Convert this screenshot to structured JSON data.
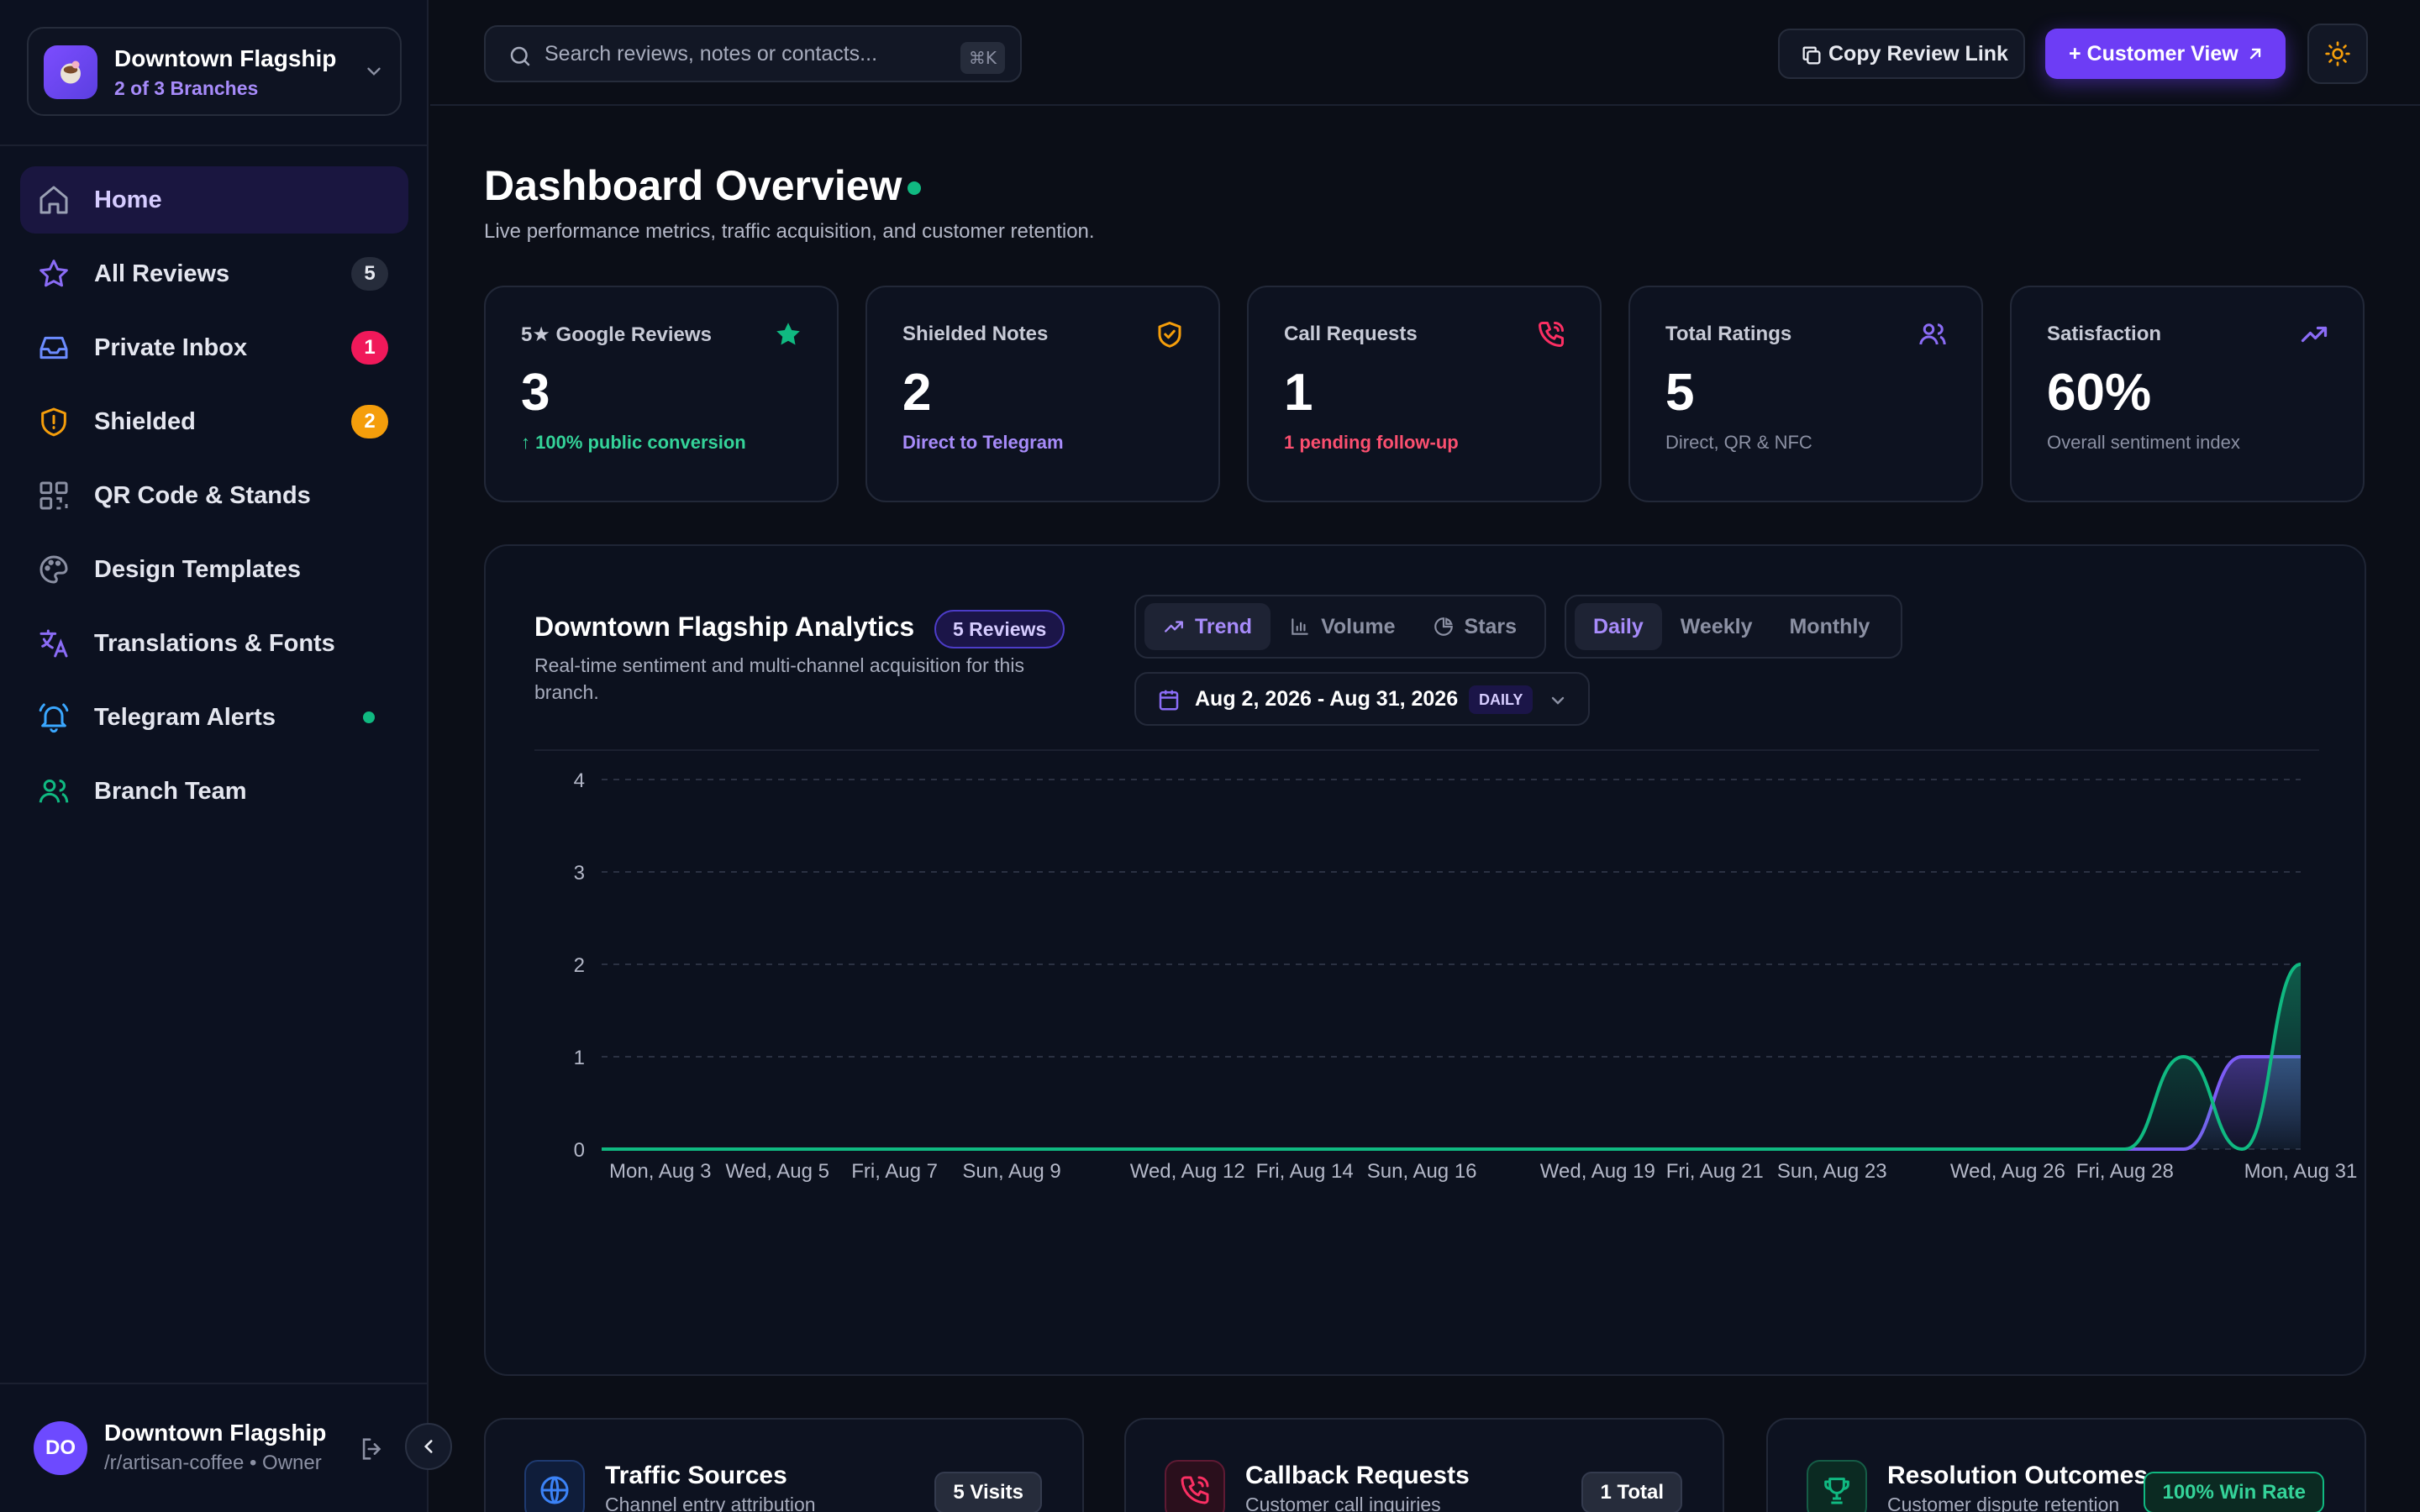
{
  "branch": {
    "name": "Downtown Flagship",
    "sub": "2 of 3 Branches"
  },
  "nav": [
    {
      "label": "Home",
      "icon": "home-icon"
    },
    {
      "label": "All Reviews",
      "badge": "5",
      "icon": "star-icon"
    },
    {
      "label": "Private Inbox",
      "badge": "1",
      "icon": "inbox-icon"
    },
    {
      "label": "Shielded",
      "badge": "2",
      "icon": "shield-icon"
    },
    {
      "label": "QR Code & Stands",
      "icon": "qr-code-icon"
    },
    {
      "label": "Design Templates",
      "icon": "palette-icon"
    },
    {
      "label": "Translations & Fonts",
      "icon": "languages-icon"
    },
    {
      "label": "Telegram Alerts",
      "icon": "bell-icon"
    },
    {
      "label": "Branch Team",
      "icon": "users-icon"
    }
  ],
  "user": {
    "initials": "DO",
    "name": "Downtown Flagship",
    "sub": "/r/artisan-coffee • Owner"
  },
  "topbar": {
    "search_placeholder": "Search reviews, notes or contacts...",
    "shortcut": "⌘K",
    "copy_label": "Copy Review Link",
    "customer_label": "+ Customer View"
  },
  "page": {
    "title": "Dashboard Overview",
    "subtitle": "Live performance metrics, traffic acquisition, and customer retention."
  },
  "stats": [
    {
      "label": "5★ Google Reviews",
      "value": "3",
      "note": "↑ 100% public conversion",
      "color": "#34d399",
      "icon": "star-icon"
    },
    {
      "label": "Shielded Notes",
      "value": "2",
      "note": "Direct to Telegram",
      "color": "#a78bfa",
      "icon": "shield-check-icon"
    },
    {
      "label": "Call Requests",
      "value": "1",
      "note": "1 pending follow-up",
      "color": "#fb4f6f",
      "icon": "phone-call-icon"
    },
    {
      "label": "Total Ratings",
      "value": "5",
      "note": "Direct, QR & NFC",
      "color": "#8b90a3",
      "icon": "users-icon"
    },
    {
      "label": "Satisfaction",
      "value": "60%",
      "note": "Overall sentiment index",
      "color": "#8b90a3",
      "icon": "trending-up-icon"
    }
  ],
  "analytics": {
    "title": "Downtown Flagship Analytics",
    "badge": "5 Reviews",
    "subtitle": "Real-time sentiment and multi-channel acquisition for this branch.",
    "views": [
      "Trend",
      "Volume",
      "Stars"
    ],
    "active_view": "Trend",
    "periods": [
      "Daily",
      "Weekly",
      "Monthly"
    ],
    "active_period": "Daily",
    "date_range": "Aug 2, 2026 - Aug 31, 2026",
    "date_tag": "DAILY"
  },
  "chart_data": {
    "type": "area",
    "title": "",
    "xlabel": "",
    "ylabel": "",
    "ylim": [
      0,
      4
    ],
    "yticks": [
      0,
      1,
      2,
      3,
      4
    ],
    "grid": true,
    "x": [
      "Aug 2",
      "Aug 3",
      "Aug 4",
      "Aug 5",
      "Aug 6",
      "Aug 7",
      "Aug 8",
      "Aug 9",
      "Aug 10",
      "Aug 11",
      "Aug 12",
      "Aug 13",
      "Aug 14",
      "Aug 15",
      "Aug 16",
      "Aug 17",
      "Aug 18",
      "Aug 19",
      "Aug 20",
      "Aug 21",
      "Aug 22",
      "Aug 23",
      "Aug 24",
      "Aug 25",
      "Aug 26",
      "Aug 27",
      "Aug 28",
      "Aug 29",
      "Aug 30",
      "Aug 31"
    ],
    "xtick_labels": [
      "Mon, Aug 3",
      "Wed, Aug 5",
      "Fri, Aug 7",
      "Sun, Aug 9",
      "Wed, Aug 12",
      "Fri, Aug 14",
      "Sun, Aug 16",
      "Wed, Aug 19",
      "Fri, Aug 21",
      "Sun, Aug 23",
      "Wed, Aug 26",
      "Fri, Aug 28",
      "Mon, Aug 31"
    ],
    "xtick_index": [
      1,
      3,
      5,
      7,
      10,
      12,
      14,
      17,
      19,
      21,
      24,
      26,
      29
    ],
    "series": [
      {
        "color": "#10b981",
        "values": [
          0,
          0,
          0,
          0,
          0,
          0,
          0,
          0,
          0,
          0,
          0,
          0,
          0,
          0,
          0,
          0,
          0,
          0,
          0,
          0,
          0,
          0,
          0,
          0,
          0,
          0,
          0,
          1,
          0,
          2
        ]
      },
      {
        "color": "#7c5cf6",
        "values": [
          0,
          0,
          0,
          0,
          0,
          0,
          0,
          0,
          0,
          0,
          0,
          0,
          0,
          0,
          0,
          0,
          0,
          0,
          0,
          0,
          0,
          0,
          0,
          0,
          0,
          0,
          0,
          0,
          1,
          1
        ]
      }
    ]
  },
  "bottom_cards": [
    {
      "title": "Traffic Sources",
      "sub": "Channel entry attribution",
      "pill": "5 Visits",
      "icon": "globe-icon"
    },
    {
      "title": "Callback Requests",
      "sub": "Customer call inquiries",
      "pill": "1 Total",
      "icon": "phone-call-icon"
    },
    {
      "title": "Resolution Outcomes",
      "sub": "Customer dispute retention",
      "pill": "100% Win Rate",
      "icon": "trophy-icon"
    }
  ]
}
